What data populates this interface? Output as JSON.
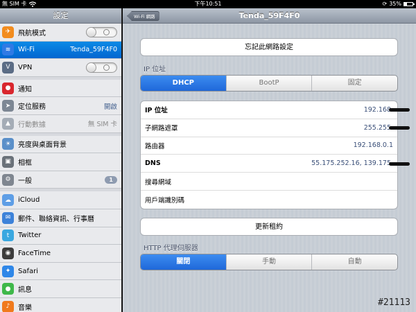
{
  "statusbar": {
    "carrier": "無 SIM 卡",
    "time": "下午10:51",
    "battery_text": "35%",
    "battery_level": 0.35
  },
  "sidebar": {
    "title": "設定",
    "items": [
      {
        "name": "airplane",
        "label": "飛航模式",
        "icon": "airplane-icon",
        "icon_color": "#f28c1e",
        "toggle": false
      },
      {
        "name": "wifi",
        "label": "Wi-Fi",
        "value": "Tenda_59F4F0",
        "icon": "wifi-icon",
        "icon_color": "#2f7ae5",
        "selected": true
      },
      {
        "name": "vpn",
        "label": "VPN",
        "icon": "vpn-icon",
        "icon_color": "#5b6c85",
        "toggle": false
      },
      {
        "name": "notifications",
        "label": "通知",
        "icon": "notification-icon",
        "icon_color": "#d9272e"
      },
      {
        "name": "location",
        "label": "定位服務",
        "value": "開啟",
        "icon": "location-icon",
        "icon_color": "#7d8794"
      },
      {
        "name": "cellular",
        "label": "行動數據",
        "value": "無 SIM 卡",
        "icon": "cellular-icon",
        "icon_color": "#a4acb6",
        "disabled": true
      },
      {
        "name": "brightness",
        "label": "亮度與桌面背景",
        "icon": "brightness-icon",
        "icon_color": "#5a8fc9"
      },
      {
        "name": "frame",
        "label": "相框",
        "icon": "picture-frame-icon",
        "icon_color": "#6a7179"
      },
      {
        "name": "general",
        "label": "一般",
        "badge": "1",
        "icon": "gear-icon",
        "icon_color": "#7f8690"
      },
      {
        "name": "icloud",
        "label": "iCloud",
        "icon": "cloud-icon",
        "icon_color": "#5e9ee6"
      },
      {
        "name": "mail",
        "label": "郵件、聯絡資訊、行事曆",
        "icon": "mail-icon",
        "icon_color": "#3d82d9"
      },
      {
        "name": "twitter",
        "label": "Twitter",
        "icon": "twitter-icon",
        "icon_color": "#3aa8e0"
      },
      {
        "name": "facetime",
        "label": "FaceTime",
        "icon": "facetime-icon",
        "icon_color": "#3c3c3c"
      },
      {
        "name": "safari",
        "label": "Safari",
        "icon": "compass-icon",
        "icon_color": "#2f87e8"
      },
      {
        "name": "messages",
        "label": "訊息",
        "icon": "message-icon",
        "icon_color": "#3fb84a"
      },
      {
        "name": "music",
        "label": "音樂",
        "icon": "music-icon",
        "icon_color": "#f07a1d"
      }
    ]
  },
  "navbar": {
    "back_label": "Wi-Fi 網路",
    "title": "Tenda_59F4F0"
  },
  "forget_button": "忘記此網路設定",
  "ip_section": {
    "label": "IP 位址",
    "tabs": [
      {
        "label": "DHCP",
        "active": true
      },
      {
        "label": "BootP",
        "active": false
      },
      {
        "label": "固定",
        "active": false
      }
    ],
    "rows": [
      {
        "label": "IP 位址",
        "value": "192.168.",
        "bold": true,
        "redacted": true
      },
      {
        "label": "子網路遮罩",
        "value": "255.255.",
        "redacted": true
      },
      {
        "label": "路由器",
        "value": "192.168.0.1"
      },
      {
        "label": "DNS",
        "value": "55.175.252.16, 139.175.",
        "bold": true,
        "redacted": true
      },
      {
        "label": "搜尋網域",
        "value": ""
      },
      {
        "label": "用戶端識別碼",
        "value": ""
      }
    ]
  },
  "renew_button": "更新租約",
  "proxy_section": {
    "label": "HTTP 代理伺服器",
    "tabs": [
      {
        "label": "關閉",
        "active": true
      },
      {
        "label": "手動",
        "active": false
      },
      {
        "label": "自動",
        "active": false
      }
    ]
  },
  "watermark": "#21113"
}
